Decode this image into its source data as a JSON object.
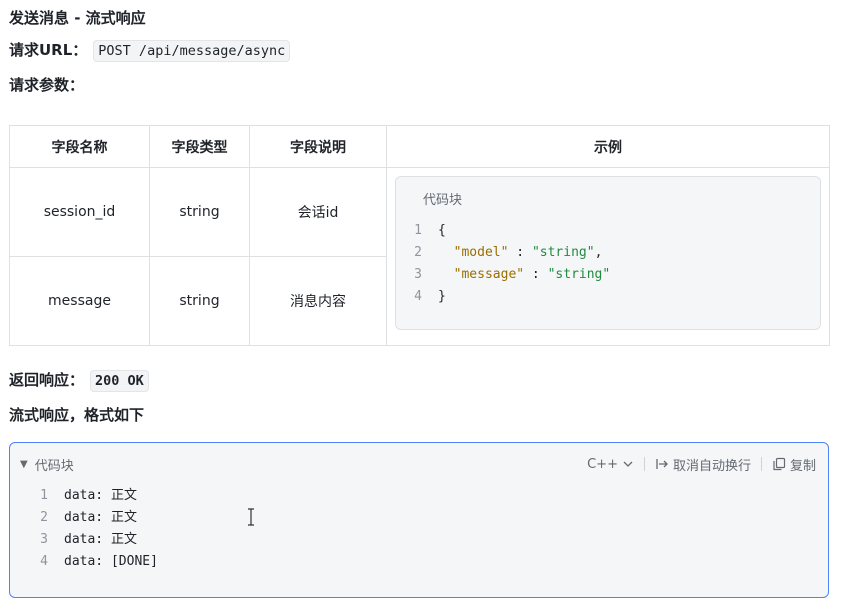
{
  "heading": "发送消息 - 流式响应",
  "request_url": {
    "label": "请求URL：",
    "value": "POST /api/message/async"
  },
  "request_params_label": "请求参数：",
  "table": {
    "headers": [
      "字段名称",
      "字段类型",
      "字段说明",
      "示例"
    ],
    "rows": [
      {
        "name": "session_id",
        "type": "string",
        "desc": "会话id"
      },
      {
        "name": "message",
        "type": "string",
        "desc": "消息内容"
      }
    ],
    "example_block": {
      "title": "代码块",
      "lines": [
        {
          "n": "1",
          "text": "{"
        },
        {
          "n": "2",
          "key": "\"model\"",
          "sep": " : ",
          "val": "\"string\"",
          "end": ","
        },
        {
          "n": "3",
          "key": "\"message\"",
          "sep": " : ",
          "val": "\"string\"",
          "end": ""
        },
        {
          "n": "4",
          "text": "}"
        }
      ]
    }
  },
  "response": {
    "label": "返回响应：",
    "value": "200 OK"
  },
  "stream_label": "流式响应，格式如下",
  "stream_block": {
    "title": "代码块",
    "language": "C++",
    "wrap_label": "取消自动换行",
    "copy_label": "复制",
    "lines": [
      {
        "n": "1",
        "text": "data: 正文"
      },
      {
        "n": "2",
        "text": "data: 正文"
      },
      {
        "n": "3",
        "text": "data: 正文"
      },
      {
        "n": "4",
        "text": "data: [DONE]"
      }
    ]
  },
  "colors": {
    "accent_border": "#4e83fd",
    "json_key": "#9a6e00",
    "json_string": "#218a41"
  }
}
